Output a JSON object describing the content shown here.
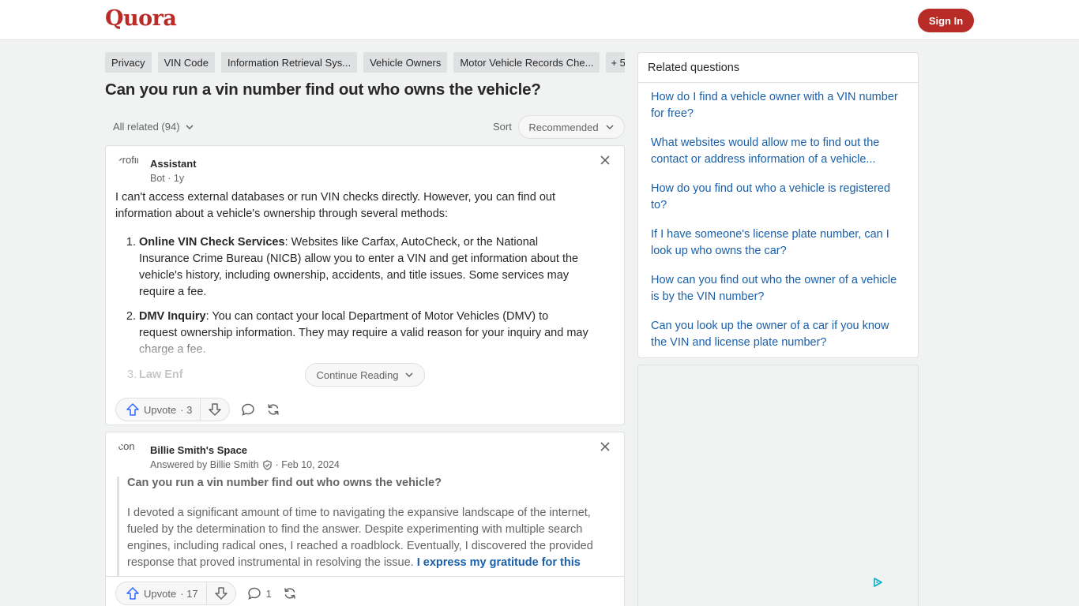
{
  "header": {
    "logo": "Quora",
    "sign_in": "Sign In"
  },
  "topics": [
    {
      "label": "Privacy"
    },
    {
      "label": "VIN Code"
    },
    {
      "label": "Information Retrieval Sys..."
    },
    {
      "label": "Vehicle Owners"
    },
    {
      "label": "Motor Vehicle Records Che..."
    },
    {
      "label": "+ 5"
    }
  ],
  "question": {
    "title": "Can you run a vin number find out who owns the vehicle?"
  },
  "filters": {
    "all_related": "All related (94)",
    "sort_label": "Sort",
    "sort_value": "Recommended"
  },
  "answer1": {
    "avatar_alt": "Profil",
    "author": "Assistant",
    "meta": "Bot · 1y",
    "intro": "I can't access external databases or run VIN checks directly. However, you can find out information about a vehicle's ownership through several methods:",
    "items": [
      {
        "term": "Online VIN Check Services",
        "text": ": Websites like Carfax, AutoCheck, or the National Insurance Crime Bureau (NICB) allow you to enter a VIN and get information about the vehicle's history, including ownership, accidents, and title issues. Some services may require a fee."
      },
      {
        "term": "DMV Inquiry",
        "text": ": You can contact your local Department of Motor Vehicles (DMV) to request ownership information. They may require a valid reason for your inquiry and may charge a fee."
      }
    ],
    "truncated_num": "3.",
    "truncated_term": "Law Enf",
    "continue": "Continue Reading",
    "upvote_label": "Upvote",
    "upvote_count": "· 3"
  },
  "answer2": {
    "avatar_alt": "Icon",
    "space": "Billie Smith's Space",
    "meta_prefix": "Answered by Billie Smith",
    "meta_date": "· Feb 10, 2024",
    "quote_question": "Can you run a vin number find out who owns the vehicle?",
    "quote_body": "I devoted a significant amount of time to navigating the expansive landscape of the internet, fueled by the determination to find the answer. Despite experimenting with multiple search engines, including radical ones, I reached a roadblock. Eventually, I discovered the provided response that proved instrumental in resolving the issue. ",
    "quote_link": "I express my gratitude for this",
    "upvote_label": "Upvote",
    "upvote_count": "· 17",
    "comment_count": "1"
  },
  "related": {
    "title": "Related questions",
    "items": [
      {
        "label": "How do I find a vehicle owner with a VIN number for free?"
      },
      {
        "label": "What websites would allow me to find out the contact or address information of a vehicle..."
      },
      {
        "label": "How do you find out who a vehicle is registered to?"
      },
      {
        "label": "If I have someone's license plate number, can I look up who owns the car?"
      },
      {
        "label": "How can you find out who the owner of a vehicle is by the VIN number?"
      },
      {
        "label": "Can you look up the owner of a car if you know the VIN and license plate number?"
      }
    ]
  },
  "colors": {
    "brand": "#b92b27",
    "link": "#195faa",
    "upvote_icon": "#2e69ff"
  },
  "icons": {
    "close": "close-icon",
    "upvote": "upvote-arrow-icon",
    "downvote": "downvote-arrow-icon",
    "comment": "comment-icon",
    "share": "share-icon",
    "chevron": "chevron-down-icon",
    "verified": "verified-badge-icon",
    "ad": "adchoices-icon"
  }
}
